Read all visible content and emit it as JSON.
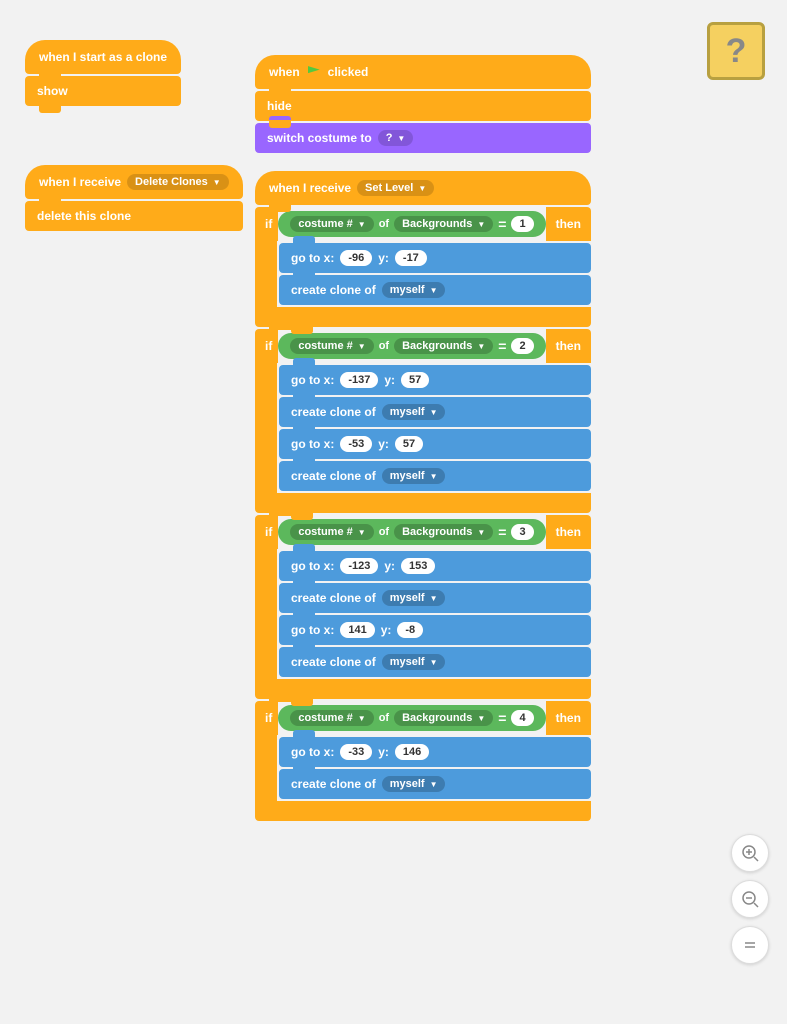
{
  "blocks": {
    "group1": {
      "hat_label": "when I start as a clone",
      "show_label": "show"
    },
    "group2": {
      "receive_label": "when I receive",
      "dropdown1": "Delete Clones",
      "delete_label": "delete this clone"
    },
    "group_main": {
      "green_flag_label": "when",
      "clicked_label": "clicked",
      "hide_label": "hide",
      "switch_label": "switch costume to",
      "costume_dropdown": "?",
      "receive2_label": "when I receive",
      "set_level_dropdown": "Set Level",
      "if_label": "if",
      "costume_hash": "costume #",
      "of_label": "of",
      "backgrounds1": "Backgrounds",
      "eq1": "=",
      "val1": "1",
      "then1": "then",
      "goto1_label": "go to x:",
      "x1": "-96",
      "y1_label": "y:",
      "y1": "-17",
      "clone1_label": "create clone of",
      "myself1": "myself",
      "backgrounds2": "Backgrounds",
      "val2": "2",
      "then2": "then",
      "goto2a_label": "go to x:",
      "x2a": "-137",
      "y2a_label": "y:",
      "y2a": "57",
      "goto2b_label": "go to x:",
      "x2b": "-53",
      "y2b_label": "y:",
      "y2b": "57",
      "backgrounds3": "Backgrounds",
      "val3": "3",
      "then3": "then",
      "goto3a_label": "go to x:",
      "x3a": "-123",
      "y3a_label": "y:",
      "y3a": "153",
      "goto3b_label": "go to x:",
      "x3b": "141",
      "y3b_label": "y:",
      "y3b": "-8",
      "backgrounds4": "Backgrounds",
      "val4": "4",
      "then4": "then",
      "goto4_label": "go to x:",
      "x4": "-33",
      "y4_label": "y:",
      "y4": "146",
      "myself_label": "myself"
    },
    "zoom": {
      "plus": "+",
      "minus": "−",
      "fit": "="
    }
  }
}
